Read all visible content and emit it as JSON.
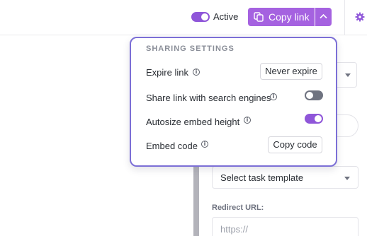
{
  "topbar": {
    "active_label": "Active",
    "active_on": true,
    "copy_link_label": "Copy link",
    "accent_color": "#a562e0"
  },
  "sharing": {
    "title": "SHARING SETTINGS",
    "expire_label": "Expire link",
    "expire_button": "Never expire",
    "search_label": "Share link with search engines",
    "search_on": false,
    "autosize_label": "Autosize embed height",
    "autosize_on": true,
    "embed_label": "Embed code",
    "embed_button": "Copy code"
  },
  "form": {
    "task_template": "Select task template",
    "redirect_label": "Redirect URL:",
    "redirect_placeholder": "https://"
  }
}
